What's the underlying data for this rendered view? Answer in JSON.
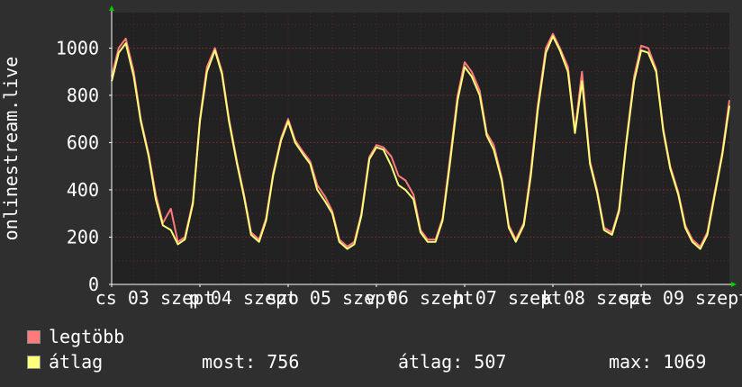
{
  "chart_data": {
    "type": "line",
    "ylabel": "onlinestream.live",
    "ylim": [
      0,
      1150
    ],
    "yticks": [
      0,
      200,
      400,
      600,
      800,
      1000
    ],
    "grid": true,
    "x_tick_labels": [
      "cs 03 szept",
      "p 04 szept",
      "szo 05 szept",
      "v 06 szept",
      "h 07 szept",
      "k 08 szept",
      "sze 09 szept"
    ],
    "colors": {
      "background": "#2f2f2f",
      "plot_area": "#222222",
      "grid": "#7a2a2a",
      "max_line": "#ff7b7b",
      "avg_line": "#ffff7a",
      "axis_arrow": "#00cc00"
    },
    "x": [
      0,
      0.08,
      0.16,
      0.25,
      0.33,
      0.42,
      0.5,
      0.58,
      0.67,
      0.75,
      0.83,
      0.92,
      1.0,
      1.08,
      1.17,
      1.25,
      1.33,
      1.42,
      1.5,
      1.58,
      1.67,
      1.75,
      1.83,
      1.92,
      2.0,
      2.08,
      2.17,
      2.25,
      2.33,
      2.42,
      2.5,
      2.58,
      2.67,
      2.75,
      2.83,
      2.92,
      3.0,
      3.08,
      3.17,
      3.25,
      3.33,
      3.42,
      3.5,
      3.58,
      3.67,
      3.75,
      3.83,
      3.92,
      4.0,
      4.08,
      4.17,
      4.25,
      4.33,
      4.42,
      4.5,
      4.58,
      4.67,
      4.75,
      4.83,
      4.92,
      5.0,
      5.08,
      5.17,
      5.25,
      5.33,
      5.42,
      5.5,
      5.58,
      5.67,
      5.75,
      5.83,
      5.92,
      6.0,
      6.08,
      6.17,
      6.25,
      6.33,
      6.42,
      6.5,
      6.58,
      6.67,
      6.75,
      6.83,
      6.92,
      7.0
    ],
    "series": [
      {
        "name": "legtöbb",
        "values": [
          880,
          1000,
          1040,
          900,
          700,
          550,
          380,
          260,
          320,
          180,
          200,
          350,
          700,
          920,
          1000,
          900,
          700,
          520,
          380,
          220,
          190,
          280,
          470,
          620,
          700,
          610,
          560,
          520,
          420,
          370,
          310,
          190,
          160,
          180,
          300,
          540,
          590,
          580,
          540,
          460,
          440,
          380,
          230,
          190,
          190,
          280,
          520,
          800,
          940,
          900,
          820,
          640,
          590,
          450,
          250,
          190,
          260,
          480,
          760,
          1000,
          1060,
          1000,
          920,
          650,
          900,
          520,
          400,
          240,
          220,
          320,
          600,
          880,
          1010,
          1000,
          910,
          660,
          500,
          390,
          250,
          190,
          160,
          220,
          380,
          560,
          780
        ]
      },
      {
        "name": "átlag",
        "values": [
          860,
          980,
          1020,
          880,
          690,
          540,
          360,
          250,
          230,
          170,
          190,
          340,
          690,
          900,
          990,
          890,
          690,
          510,
          370,
          210,
          180,
          270,
          460,
          610,
          690,
          600,
          550,
          510,
          400,
          350,
          300,
          180,
          150,
          170,
          290,
          530,
          580,
          570,
          500,
          420,
          400,
          360,
          220,
          180,
          180,
          270,
          500,
          780,
          920,
          880,
          800,
          630,
          570,
          440,
          240,
          180,
          250,
          460,
          740,
          980,
          1050,
          990,
          900,
          640,
          860,
          510,
          390,
          230,
          210,
          310,
          590,
          860,
          990,
          980,
          900,
          650,
          490,
          380,
          240,
          180,
          150,
          210,
          370,
          550,
          756
        ]
      }
    ]
  },
  "legend": {
    "max_label": "legtöbb",
    "avg_label": "átlag"
  },
  "stats": {
    "now": "most: 756",
    "average": "átlag: 507",
    "maximum": "max: 1069"
  }
}
